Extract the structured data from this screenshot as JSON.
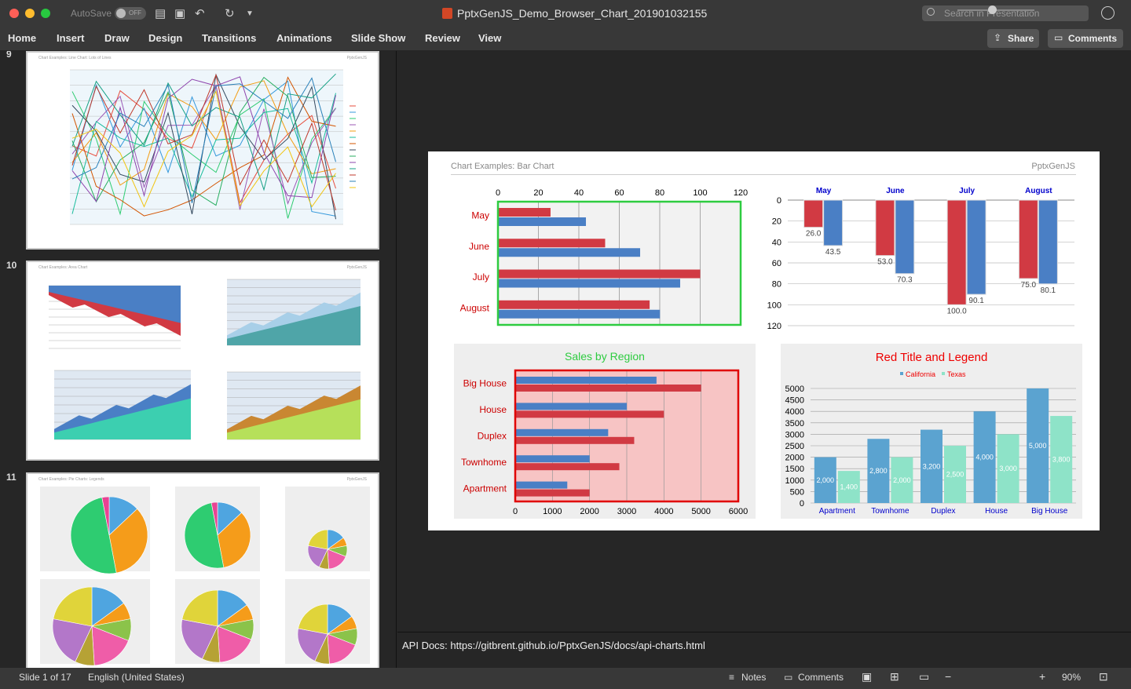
{
  "window": {
    "autosave_label": "AutoSave",
    "autosave_state": "OFF",
    "title": "PptxGenJS_Demo_Browser_Chart_201901032155",
    "search_placeholder": "Search in Presentation"
  },
  "ribbon": {
    "tabs": [
      "Home",
      "Insert",
      "Draw",
      "Design",
      "Transitions",
      "Animations",
      "Slide Show",
      "Review",
      "View"
    ],
    "share_label": "Share",
    "comments_label": "Comments"
  },
  "sidebar": {
    "slides": [
      {
        "number": "9",
        "title": "Chart Examples: Line Chart: Lots of Lines",
        "brand": "PptxGenJS"
      },
      {
        "number": "10",
        "title": "Chart Examples: Area Chart",
        "brand": "PptxGenJS"
      },
      {
        "number": "11",
        "title": "Chart Examples: Pie Charts: Legends",
        "brand": "PptxGenJS"
      }
    ]
  },
  "slide": {
    "title": "Chart Examples: Bar Chart",
    "brand": "PptxGenJS"
  },
  "notes": {
    "text": "API Docs: https://gitbrent.github.io/PptxGenJS/docs/api-charts.html"
  },
  "status": {
    "slide_counter": "Slide 1 of 17",
    "language": "English (United States)",
    "notes_label": "Notes",
    "comments_label": "Comments",
    "zoom": "90%"
  },
  "colors": {
    "red": "#d13a43",
    "blue": "#4a7fc5",
    "green_border": "#2ecc40",
    "red_border": "#e00000"
  },
  "chart_data": [
    {
      "type": "bar",
      "orientation": "horizontal",
      "categories": [
        "May",
        "June",
        "July",
        "August"
      ],
      "series": [
        {
          "values": [
            26,
            53,
            100,
            75
          ]
        },
        {
          "values": [
            43.5,
            70.3,
            90.1,
            80.1
          ]
        }
      ],
      "xlim": [
        0,
        120
      ],
      "x_ticks": [
        0,
        20,
        40,
        60,
        80,
        100,
        120
      ]
    },
    {
      "type": "bar",
      "orientation": "vertical-inverted",
      "categories": [
        "May",
        "June",
        "July",
        "August"
      ],
      "series": [
        {
          "values": [
            26.0,
            53.0,
            100.0,
            75.0
          ]
        },
        {
          "values": [
            43.5,
            70.3,
            90.1,
            80.1
          ]
        }
      ],
      "ylim": [
        0,
        120
      ],
      "y_ticks": [
        0,
        20,
        40,
        60,
        80,
        100,
        120
      ],
      "data_labels": [
        "26.0",
        "43.5",
        "53.0",
        "70.3",
        "100.0",
        "90.1",
        "75.0",
        "80.1"
      ]
    },
    {
      "type": "bar",
      "orientation": "horizontal",
      "title": "Sales by Region",
      "categories": [
        "Big House",
        "House",
        "Duplex",
        "Townhome",
        "Apartment"
      ],
      "series": [
        {
          "values": [
            3800,
            3000,
            2500,
            2000,
            1400
          ]
        },
        {
          "values": [
            5000,
            4000,
            3200,
            2800,
            2000
          ]
        }
      ],
      "xlim": [
        0,
        6000
      ],
      "x_ticks": [
        0,
        1000,
        2000,
        3000,
        4000,
        5000,
        6000
      ]
    },
    {
      "type": "bar",
      "orientation": "vertical",
      "title": "Red Title and Legend",
      "legend": [
        "California",
        "Texas"
      ],
      "categories": [
        "Apartment",
        "Townhome",
        "Duplex",
        "House",
        "Big House"
      ],
      "series": [
        {
          "name": "California",
          "values": [
            2000,
            2800,
            3200,
            4000,
            5000
          ]
        },
        {
          "name": "Texas",
          "values": [
            1400,
            2000,
            2500,
            3000,
            3800
          ]
        }
      ],
      "ylim": [
        0,
        5000
      ],
      "y_ticks": [
        0,
        500,
        1000,
        1500,
        2000,
        2500,
        3000,
        3500,
        4000,
        4500,
        5000
      ],
      "data_labels": [
        "2,000",
        "1,400",
        "2,800",
        "2,000",
        "3,200",
        "2,500",
        "4,000",
        "3,000",
        "5,000",
        "3,800"
      ]
    }
  ]
}
